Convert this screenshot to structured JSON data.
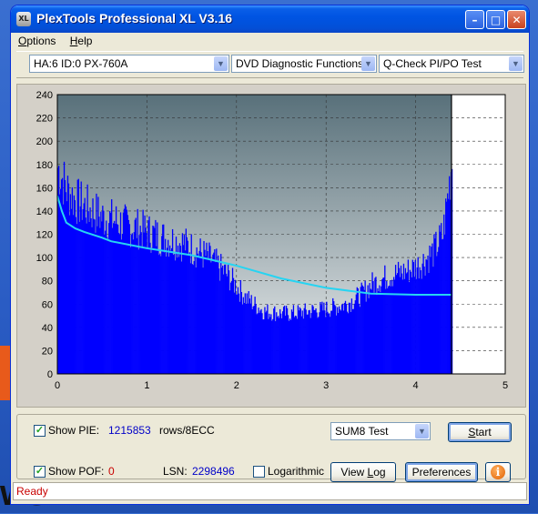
{
  "window": {
    "title": "PlexTools Professional XL V3.16",
    "icon_text": "XL"
  },
  "title_buttons": {
    "minimize": "minimize-icon",
    "maximize": "maximize-icon",
    "close": "close-icon"
  },
  "menu": [
    {
      "label": "Options",
      "accel": "O",
      "rest": "ptions"
    },
    {
      "label": "Help",
      "accel": "H",
      "rest": "elp"
    }
  ],
  "toolbar": {
    "drive": "HA:6 ID:0  PX-760A",
    "function": "DVD Diagnostic Functions",
    "test": "Q-Check PI/PO Test"
  },
  "chart_data": {
    "type": "bar",
    "xlim": [
      0,
      5
    ],
    "ylim": [
      0,
      240
    ],
    "x_ticks": [
      "0",
      "1",
      "2",
      "3",
      "4",
      "5"
    ],
    "y_ticks": [
      "0",
      "20",
      "40",
      "60",
      "80",
      "100",
      "120",
      "140",
      "160",
      "180",
      "200",
      "220",
      "240"
    ],
    "end_marker_x": 4.4,
    "grid": true,
    "series": [
      {
        "kind": "bars",
        "color": "#0000ff",
        "x": [
          0.0,
          0.1,
          0.2,
          0.3,
          0.4,
          0.5,
          0.6,
          0.7,
          0.8,
          0.9,
          1.0,
          1.1,
          1.2,
          1.3,
          1.4,
          1.5,
          1.6,
          1.7,
          1.8,
          1.9,
          2.0,
          2.1,
          2.2,
          2.3,
          2.4,
          2.5,
          2.6,
          2.7,
          2.8,
          2.9,
          3.0,
          3.1,
          3.2,
          3.3,
          3.4,
          3.5,
          3.6,
          3.7,
          3.8,
          3.9,
          4.0,
          4.1,
          4.2,
          4.3,
          4.4
        ],
        "y": [
          185,
          165,
          155,
          150,
          145,
          140,
          138,
          135,
          132,
          130,
          127,
          124,
          121,
          119,
          117,
          112,
          108,
          103,
          96,
          88,
          78,
          68,
          62,
          56,
          55,
          54,
          54,
          55,
          56,
          57,
          58,
          60,
          62,
          66,
          72,
          80,
          84,
          88,
          90,
          92,
          96,
          102,
          110,
          125,
          190
        ]
      },
      {
        "kind": "line",
        "color": "#26d4f2",
        "x": [
          0.0,
          0.05,
          0.1,
          0.2,
          0.3,
          0.5,
          0.6,
          1.0,
          1.5,
          2.0,
          2.5,
          3.0,
          3.3,
          3.5,
          4.0,
          4.4
        ],
        "y": [
          153,
          140,
          130,
          125,
          122,
          117,
          114,
          108,
          102,
          93,
          82,
          74,
          71,
          69,
          68,
          68
        ]
      }
    ]
  },
  "controls": {
    "show_pie": {
      "label": "Show PIE:",
      "checked": true,
      "value": "1215853",
      "unit": "rows/8ECC"
    },
    "show_pof": {
      "label": "Show POF:",
      "checked": true,
      "value": "0"
    },
    "lsn": {
      "label": "LSN:",
      "value": "2298496"
    },
    "logarithmic": {
      "label": "Logarithmic",
      "checked": false
    },
    "test_select": "SUM8 Test",
    "buttons": {
      "start": "Start",
      "view_log": "View Log",
      "preferences": "Preferences"
    }
  },
  "status": "Ready",
  "colors": {
    "bg_top": "#58707a",
    "bg_bottom": "#eef0f0",
    "bars": "#0000ff",
    "line": "#26d4f2",
    "status_text": "#c80000",
    "value_text": "#0000c8"
  }
}
